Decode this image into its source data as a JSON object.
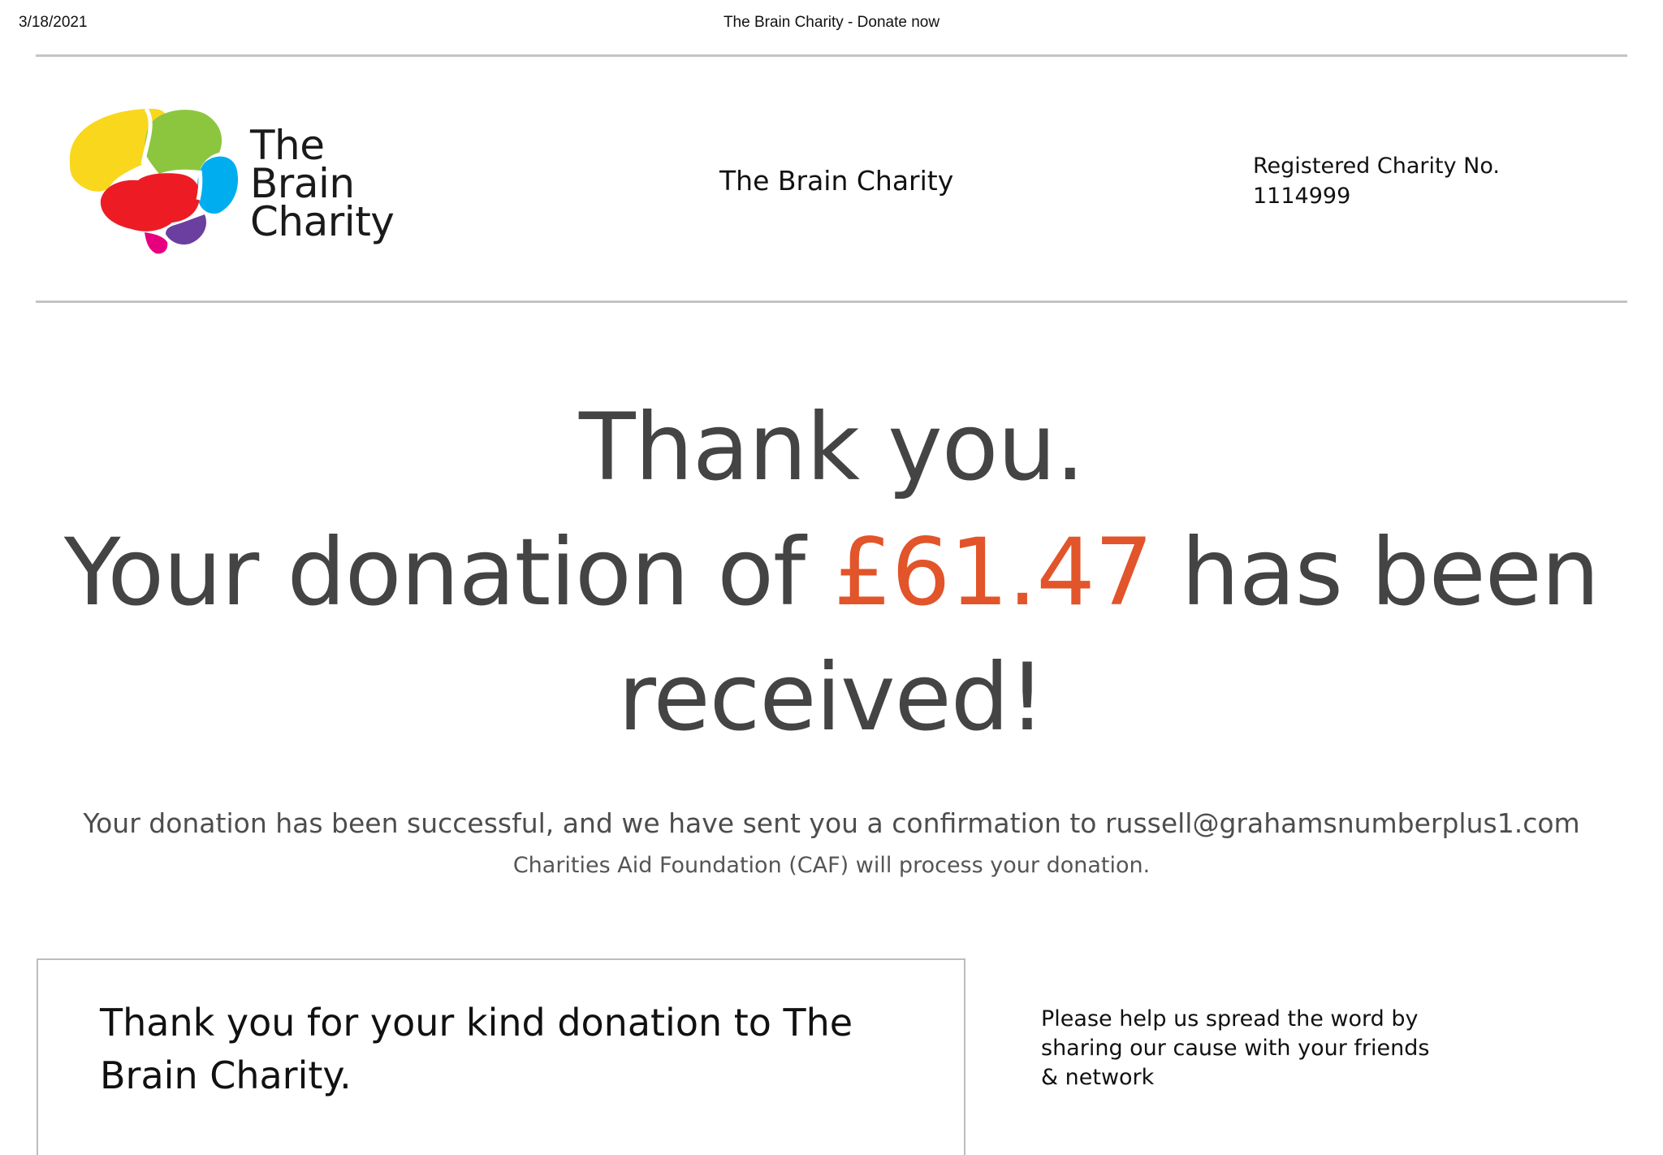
{
  "print_header": {
    "date": "3/18/2021",
    "title": "The Brain Charity - Donate now"
  },
  "logo": {
    "line1": "The",
    "line2": "Brain",
    "line3": "Charity",
    "colors": {
      "yellow": "#f9d71c",
      "green": "#8cc63f",
      "blue": "#00aeef",
      "red": "#ed1c24",
      "purple": "#6b3fa0",
      "pink": "#e6007e"
    }
  },
  "header": {
    "center_title": "The Brain Charity",
    "registered_label": "Registered Charity No.",
    "registered_number": "1114999"
  },
  "hero": {
    "line1": "Thank you.",
    "line2_prefix": "Your donation of ",
    "amount": "£61.47",
    "line2_suffix": " has been",
    "line3": "received!",
    "amount_color": "#e2542a"
  },
  "confirmation": {
    "success_text": "Your donation has been successful, and we have sent you a confirmation to russell@grahamsnumberplus1.com",
    "caf_text": "Charities Aid Foundation (CAF) will process your donation."
  },
  "card": {
    "text": "Thank you for your kind donation to The Brain Charity."
  },
  "share": {
    "text": "Please help us spread the word by sharing our cause with your friends & network"
  }
}
